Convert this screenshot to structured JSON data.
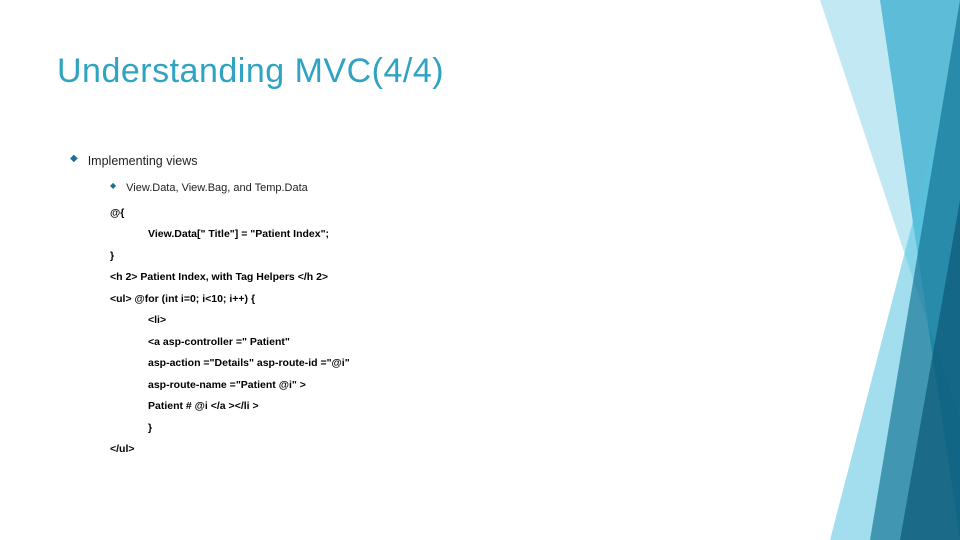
{
  "title": "Understanding MVC(4/4)",
  "bullets": {
    "lvl1": "Implementing views",
    "lvl2": "View.Data, View.Bag, and Temp.Data"
  },
  "code": {
    "l0": "@{",
    "l1": "View.Data[\" Title\"] = \"Patient Index\";",
    "l2": "}",
    "l3": "<h 2> Patient Index, with Tag Helpers </h 2>",
    "l4": "<ul> @for (int i=0; i<10; i++) {",
    "l5": "<li>",
    "l6": "<a asp-controller =\" Patient\"",
    "l7": "asp-action =\"Details\" asp-route-id =\"@i\"",
    "l8": "asp-route-name =\"Patient @i\" >",
    "l9": "Patient # @i </a ></li >",
    "l10": "}",
    "l11": "</ul>"
  }
}
